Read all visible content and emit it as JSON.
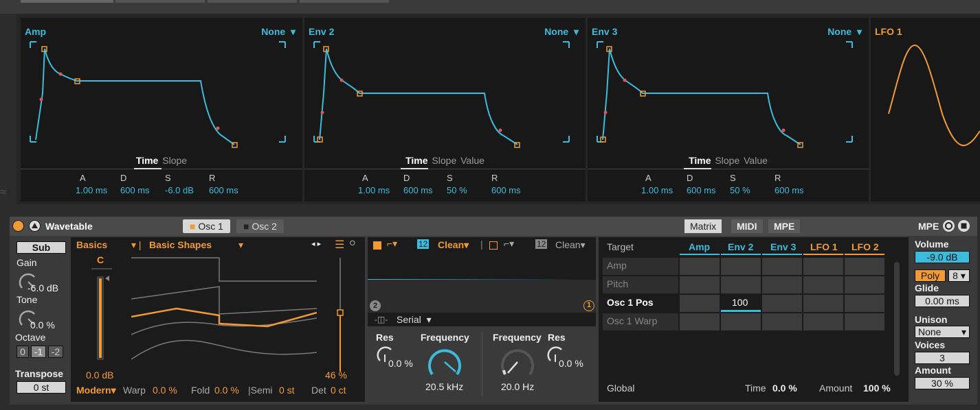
{
  "envelopes": [
    {
      "title": "Amp",
      "dest": "None",
      "tabs": [
        "Time",
        "Slope"
      ],
      "labels": [
        "A",
        "D",
        "S",
        "R"
      ],
      "values": [
        "1.00 ms",
        "600 ms",
        "-6.0 dB",
        "600 ms"
      ]
    },
    {
      "title": "Env 2",
      "dest": "None",
      "tabs": [
        "Time",
        "Slope",
        "Value"
      ],
      "labels": [
        "A",
        "D",
        "S",
        "R"
      ],
      "values": [
        "1.00 ms",
        "600 ms",
        "50 %",
        "600 ms"
      ]
    },
    {
      "title": "Env 3",
      "dest": "None",
      "tabs": [
        "Time",
        "Slope",
        "Value"
      ],
      "labels": [
        "A",
        "D",
        "S",
        "R"
      ],
      "values": [
        "1.00 ms",
        "600 ms",
        "50 %",
        "600 ms"
      ]
    }
  ],
  "lfo1": {
    "title": "LFO 1"
  },
  "device": {
    "title": "Wavetable",
    "osc_tabs": [
      "Osc 1",
      "Osc 2"
    ],
    "matrix_tabs": [
      "Matrix",
      "MIDI",
      "MPE"
    ],
    "mpe_label": "MPE"
  },
  "sub": {
    "sub_label": "Sub",
    "gain_label": "Gain",
    "gain_value": "-6.0 dB",
    "tone_label": "Tone",
    "tone_value": "0.0 %",
    "octave_label": "Octave",
    "octave_options": [
      "0",
      "-1",
      "-2"
    ],
    "transpose_label": "Transpose",
    "transpose_value": "0 st"
  },
  "osc": {
    "category": "Basics",
    "wavetable": "Basic Shapes",
    "note": "C",
    "gain_value": "0.0 dB",
    "pos_value": "46 %",
    "mode": "Modern",
    "warp_label": "Warp",
    "warp_value": "0.0 %",
    "fold_label": "Fold",
    "fold_value": "0.0 %",
    "semi_label": "Semi",
    "semi_value": "0 st",
    "det_label": "Det",
    "det_value": "0 ct"
  },
  "filter": {
    "f1_slope": "12",
    "f1_type": "Clean",
    "f2_slope": "12",
    "f2_type": "Clean",
    "routing": "Serial",
    "badge2": "2",
    "badge1": "1",
    "f1_res_label": "Res",
    "f1_res_value": "0.0 %",
    "f1_freq_label": "Frequency",
    "f1_freq_value": "20.5 kHz",
    "f2_freq_label": "Frequency",
    "f2_freq_value": "20.0 Hz",
    "f2_res_label": "Res",
    "f2_res_value": "0.0 %"
  },
  "matrix": {
    "target_label": "Target",
    "sources": [
      "Amp",
      "Env 2",
      "Env 3",
      "LFO 1",
      "LFO 2"
    ],
    "targets": [
      "Amp",
      "Pitch",
      "Osc 1 Pos",
      "Osc 1 Warp"
    ],
    "cell_value": "100",
    "global_label": "Global",
    "time_label": "Time",
    "time_value": "0.0 %",
    "amount_label": "Amount",
    "amount_value": "100 %"
  },
  "global": {
    "volume_label": "Volume",
    "volume_value": "-9.0 dB",
    "poly_label": "Poly",
    "poly_voices": "8",
    "glide_label": "Glide",
    "glide_value": "0.00 ms",
    "unison_label": "Unison",
    "unison_mode": "None",
    "voices_label": "Voices",
    "voices_value": "3",
    "amount_label": "Amount",
    "amount_value": "30 %"
  }
}
